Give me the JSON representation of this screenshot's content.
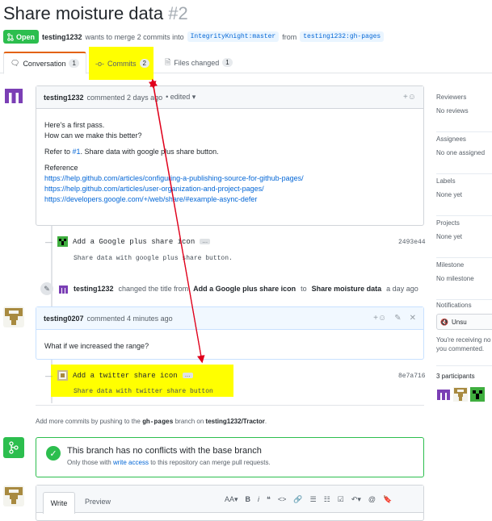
{
  "pr": {
    "title": "Share moisture data",
    "number": "#2",
    "state": "Open",
    "author": "testing1232",
    "merge_text": "wants to merge 2 commits into",
    "base_branch": "IntegrityKnight:master",
    "from_text": "from",
    "head_branch": "testing1232:gh-pages"
  },
  "tabs": [
    {
      "label": "Conversation",
      "count": "1"
    },
    {
      "label": "Commits",
      "count": "2"
    },
    {
      "label": "Files changed",
      "count": "1"
    }
  ],
  "comment1": {
    "author": "testing1232",
    "action": "commented 2 days ago",
    "edited": "• edited ▾",
    "lines": [
      "Here's a first pass.",
      "How can we make this better?"
    ],
    "refer_prefix": "Refer to",
    "refer_link": "#1",
    "refer_suffix": ". Share data with google plus share button.",
    "reference_label": "Reference",
    "links": [
      "https://help.github.com/articles/configuring-a-publishing-source-for-github-pages/",
      "https://help.github.com/articles/user-organization-and-project-pages/",
      "https://developers.google.com/+/web/share/#example-async-defer"
    ]
  },
  "commit1": {
    "title": "Add a Google plus share icon",
    "ellipsis": "…",
    "description": "Share data with google plus share button.",
    "sha": "2493e44"
  },
  "title_change": {
    "author": "testing1232",
    "text1": "changed the title from",
    "old": "Add a Google plus share icon",
    "to": "to",
    "new": "Share moisture data",
    "time": "a day ago"
  },
  "comment2": {
    "author": "testing0207",
    "action": "commented 4 minutes ago",
    "body": "What if we increased the range?"
  },
  "commit2": {
    "title": "Add a twitter share icon",
    "ellipsis": "…",
    "description": "Share data with twitter share button",
    "sha": "8e7a716"
  },
  "push_hint": {
    "prefix": "Add more commits by pushing to the",
    "branch": "gh-pages",
    "middle": "branch on",
    "repo": "testing1232/Tractor",
    "suffix": "."
  },
  "merge": {
    "title": "This branch has no conflicts with the base branch",
    "sub_prefix": "Only those with",
    "sub_link": "write access",
    "sub_suffix": "to this repository can merge pull requests."
  },
  "editor": {
    "tabs": [
      "Write",
      "Preview"
    ],
    "toolbar": [
      "AA▾",
      "B",
      "i",
      "❝",
      "<>",
      "🔗",
      "☰",
      "☷",
      "☑",
      "↶▾",
      "@",
      "🔖"
    ]
  },
  "sidebar": [
    {
      "heading": "Reviewers",
      "value": "No reviews"
    },
    {
      "heading": "Assignees",
      "value": "No one assigned"
    },
    {
      "heading": "Labels",
      "value": "None yet"
    },
    {
      "heading": "Projects",
      "value": "None yet"
    },
    {
      "heading": "Milestone",
      "value": "No milestone"
    }
  ],
  "notifications": {
    "heading": "Notifications",
    "button": "Unsu",
    "text": "You're receiving no you commented."
  },
  "participants": {
    "heading": "3 participants"
  },
  "colors": {
    "accent": "#0366d6",
    "green": "#2cbe4e",
    "highlight": "#ffff00",
    "arrow": "#e0001b"
  }
}
